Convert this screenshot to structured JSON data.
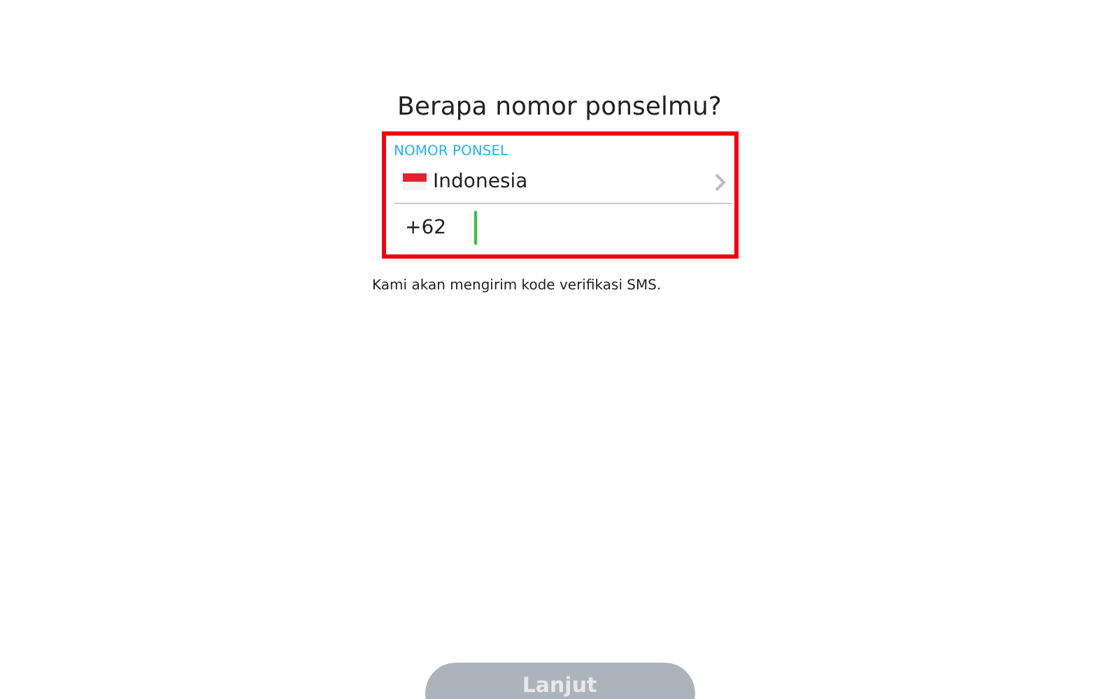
{
  "title": "Berapa nomor ponselmu?",
  "phone_field": {
    "label": "NOMOR PONSEL",
    "country": "Indonesia",
    "country_code": "+62",
    "focused": true
  },
  "hint": "Kami akan mengirim kode verifikasi SMS.",
  "continue_button": {
    "label": "Lanjut",
    "disabled": true
  }
}
